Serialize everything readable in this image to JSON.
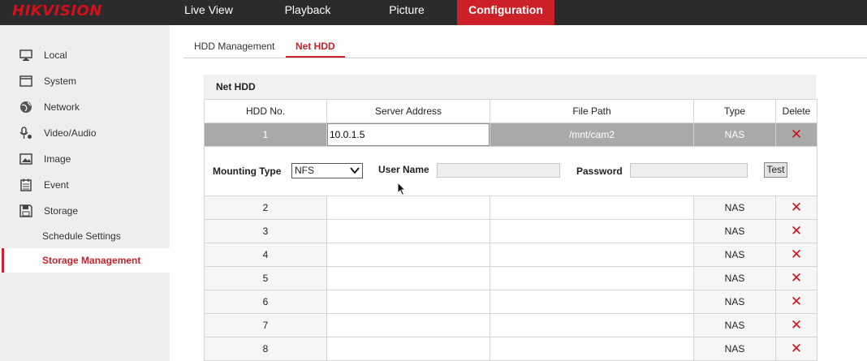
{
  "header": {
    "logo": "HIKVISION",
    "nav": [
      "Live View",
      "Playback",
      "Picture",
      "Configuration"
    ]
  },
  "sidebar": {
    "items": [
      {
        "label": "Local",
        "icon": "monitor-icon"
      },
      {
        "label": "System",
        "icon": "system-icon"
      },
      {
        "label": "Network",
        "icon": "globe-icon"
      },
      {
        "label": "Video/Audio",
        "icon": "video-audio-icon"
      },
      {
        "label": "Image",
        "icon": "image-icon"
      },
      {
        "label": "Event",
        "icon": "calendar-icon"
      },
      {
        "label": "Storage",
        "icon": "disk-icon"
      }
    ],
    "sub_items": [
      "Schedule Settings",
      "Storage Management"
    ]
  },
  "tabs": [
    "HDD Management",
    "Net HDD"
  ],
  "panel": {
    "title": "Net HDD",
    "columns": [
      "HDD No.",
      "Server Address",
      "File Path",
      "Type",
      "Delete"
    ],
    "selected": {
      "no": "1",
      "server_address": "10.0.1.5",
      "file_path": "/mnt/cam2",
      "type": "NAS"
    },
    "mounting": {
      "mounting_type_label": "Mounting Type",
      "mounting_type_value": "NFS",
      "user_name_label": "User Name",
      "password_label": "Password",
      "test_label": "Test"
    },
    "rows": [
      {
        "no": "2",
        "type": "NAS"
      },
      {
        "no": "3",
        "type": "NAS"
      },
      {
        "no": "4",
        "type": "NAS"
      },
      {
        "no": "5",
        "type": "NAS"
      },
      {
        "no": "6",
        "type": "NAS"
      },
      {
        "no": "7",
        "type": "NAS"
      },
      {
        "no": "8",
        "type": "NAS"
      }
    ]
  },
  "colors": {
    "accent": "#cc2129",
    "topbar": "#2b2b2b",
    "sidebar": "#eeeeee"
  }
}
